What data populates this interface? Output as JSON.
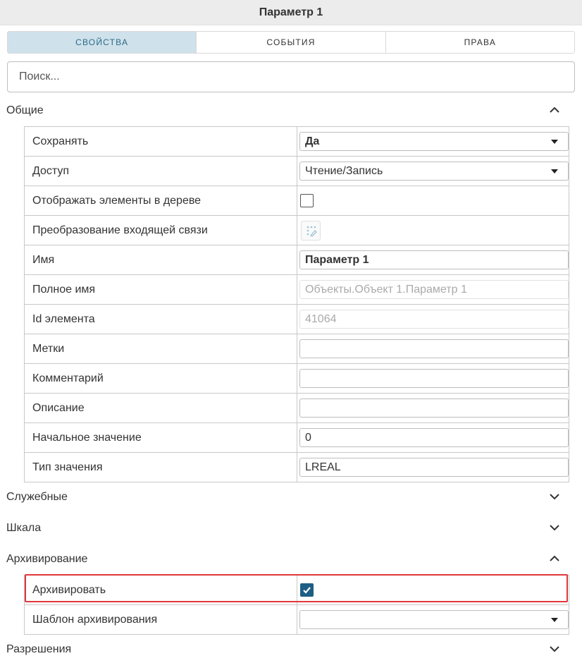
{
  "window": {
    "title": "Параметр 1"
  },
  "tabs": [
    {
      "label": "СВОЙСТВА",
      "active": true
    },
    {
      "label": "СОБЫТИЯ",
      "active": false
    },
    {
      "label": "ПРАВА",
      "active": false
    }
  ],
  "search": {
    "placeholder": "Поиск..."
  },
  "sections": {
    "general": {
      "label": "Общие",
      "expanded": true
    },
    "service": {
      "label": "Служебные",
      "expanded": false
    },
    "scale": {
      "label": "Шкала",
      "expanded": false
    },
    "archiving": {
      "label": "Архивирование",
      "expanded": true
    },
    "permissions": {
      "label": "Разрешения",
      "expanded": false
    }
  },
  "general_rows": {
    "save": {
      "label": "Сохранять",
      "value": "Да"
    },
    "access": {
      "label": "Доступ",
      "value": "Чтение/Запись"
    },
    "show_tree": {
      "label": "Отображать элементы в дереве",
      "checked": false
    },
    "transform": {
      "label": "Преобразование входящей связи",
      "icon": "link-transform-icon"
    },
    "name": {
      "label": "Имя",
      "value": "Параметр 1"
    },
    "full_name": {
      "label": "Полное имя",
      "value": "Объекты.Объект 1.Параметр 1"
    },
    "element_id": {
      "label": "Id элемента",
      "value": "41064"
    },
    "tags": {
      "label": "Метки",
      "value": ""
    },
    "comment": {
      "label": "Комментарий",
      "value": ""
    },
    "description": {
      "label": "Описание",
      "value": ""
    },
    "initial_value": {
      "label": "Начальное значение",
      "value": "0"
    },
    "value_type": {
      "label": "Тип значения",
      "value": "LREAL"
    }
  },
  "archiving_rows": {
    "archive": {
      "label": "Архивировать",
      "checked": true
    },
    "template": {
      "label": "Шаблон архивирования",
      "value": ""
    }
  },
  "colors": {
    "active_tab_bg": "#cfe1ea",
    "active_tab_text": "#2b6a8a",
    "checkbox_checked": "#1d5e85",
    "highlight": "#e0373b"
  }
}
